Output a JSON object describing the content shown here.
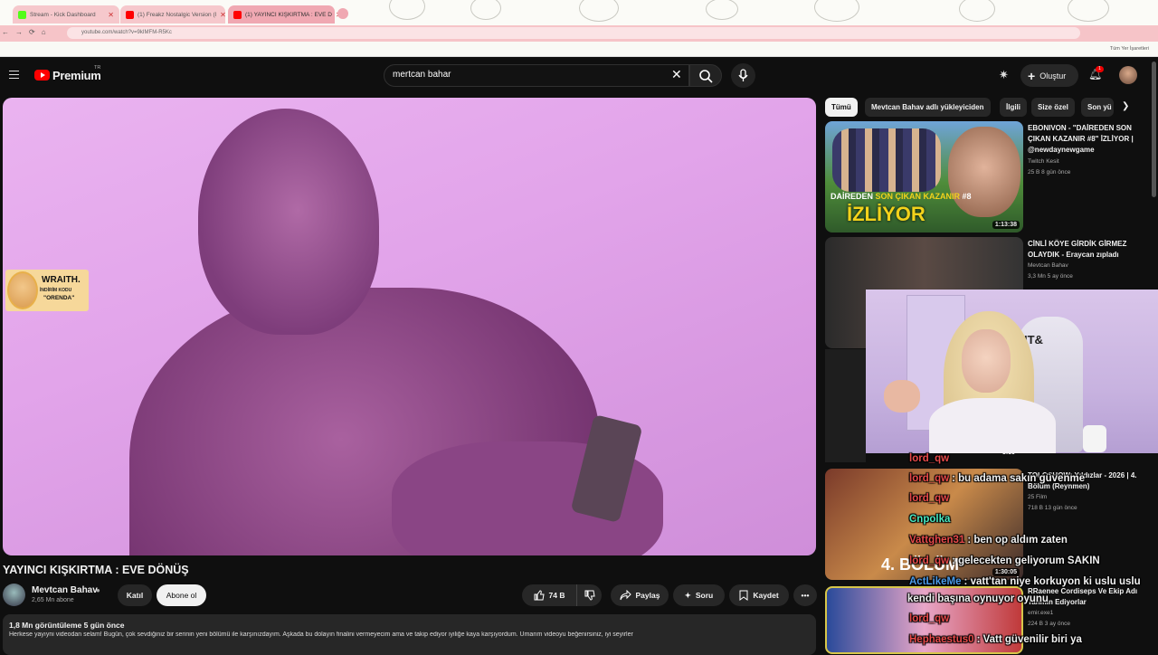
{
  "browser": {
    "tabs": [
      {
        "label": "Stream - Kick Dashboard",
        "color": "#53fc18"
      },
      {
        "label": "(1) Freakz Nostalgic Version (l",
        "color": "#ff0000"
      },
      {
        "label": "(1) YAYINCI KIŞKIRTMA : EVE D",
        "color": "#ff0000"
      }
    ],
    "url": "youtube.com/watch?v=9kIMFM-R5Kc",
    "bookmarks_label": "Tüm Yer İşaretleri"
  },
  "header": {
    "logo": "Premium",
    "region": "TR",
    "search_value": "mertcan bahar",
    "create_label": "Oluştur",
    "notification_count": "1"
  },
  "video": {
    "promo": {
      "title": "WRAITH.",
      "line1": "İNDİRİM KODU",
      "line2": "\"ORENDA\""
    },
    "title": "YAYINCI KIŞKIRTMA : EVE DÖNÜŞ",
    "channel": "Mevtcan Bahav",
    "subscribers": "2,65 Mn abone",
    "join_label": "Katıl",
    "subscribe_label": "Abone ol",
    "likes": "74 B",
    "share_label": "Paylaş",
    "ask_label": "Soru",
    "save_label": "Kaydet",
    "views_date": "1,8 Mn görüntüleme  5 gün önce",
    "description": "Herkese yayıyni videodan selam! Bugün, çok sevdiğiniz bir serinin yeni bölümü ile karşınızdayım. Aşkada bu dolayın finalini vermeyecim ama ve takip ediyor iyiliğe kaya karşıyordum. Umarım videoyu beğenirsiniz, iyi seyirler"
  },
  "chips": [
    "Tümü",
    "Mevtcan Bahav adlı yükleyiciden",
    "İlgili",
    "Size özel",
    "Son yü"
  ],
  "recommendations": [
    {
      "title": "EBONIVON - \"DAİREDEN SON ÇIKAN KAZANIR #8\" İZLİYOR | @newdaynewgame",
      "channel": "Twitch Kesit",
      "meta": "25 B  8 gün önce",
      "duration": "1:13:38",
      "caption_white": "DAİREDEN ",
      "caption_yellow": "SON ÇIKAN KAZANIR",
      "caption_tail": " #8",
      "caption_big": "İZLİYOR"
    },
    {
      "title": "CİNLİ KÖYE GİRDİK GİRMEZ OLAYDIK - Eraycan zıpladı",
      "channel": "Mevtcan Bahav",
      "meta": "3,3 Mn  5 ay önce"
    },
    {
      "title": "TOLGSHOW: Yıldızlar - 2026 | 4. Bölüm (Reynmen)",
      "channel": "25 Film",
      "meta": "718 B  13 gün önce",
      "duration": "1:30:05",
      "caption": "4. BÖLÜM"
    },
    {
      "title": "RRaenee Cordiseps Ve Ekip Adı Tahmin Ediyorlar",
      "channel": "emir.exe1",
      "meta": "224 B  3 ay önce"
    }
  ],
  "pip_duration": "3:39",
  "webcam_text": "IT&",
  "chat": [
    {
      "user": "lord_qw",
      "msg": "",
      "color": "#e84a4a"
    },
    {
      "user": "lord_qw",
      "msg": "bu adama sakın güvenme",
      "color": "#e84a4a"
    },
    {
      "user": "lord_qw",
      "msg": "",
      "color": "#e84a4a"
    },
    {
      "user": "Cnpolka",
      "msg": "",
      "color": "#4ae8c0"
    },
    {
      "user": "Vattghen31",
      "msg": "ben op aldım zaten",
      "color": "#e84a4a"
    },
    {
      "user": "lord_qw",
      "msg": "gelecekten geliyorum SAKIN",
      "color": "#e84a4a"
    },
    {
      "user": "ActLikeMe",
      "msg": "vatt'tan niye korkuyon ki uslu uslu",
      "color": "#4a9ae8"
    },
    {
      "user": "",
      "msg": "kendi başına oynuyor oyunu",
      "color": "#ffffff"
    },
    {
      "user": "lord_qw",
      "msg": "",
      "color": "#e84a4a"
    },
    {
      "user": "Hephaestus0",
      "msg": "Vatt güvenilir biri ya",
      "color": "#e84a4a"
    }
  ]
}
